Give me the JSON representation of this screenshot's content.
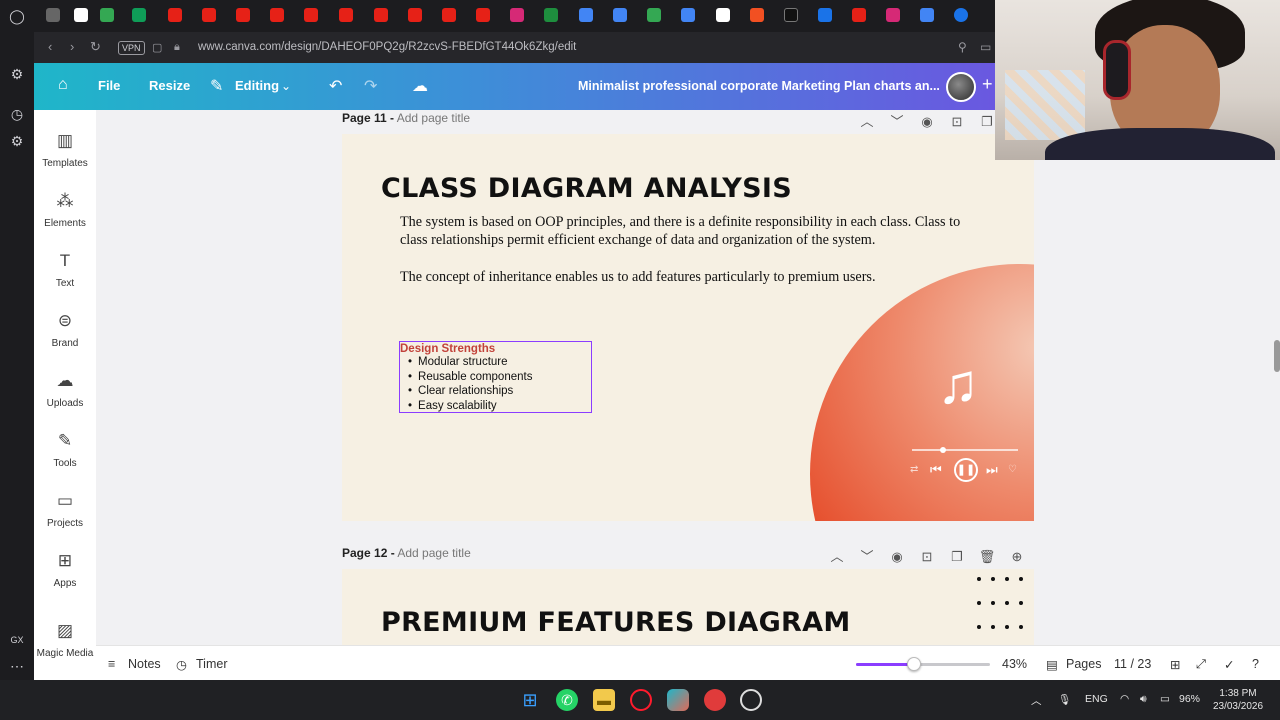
{
  "browser": {
    "vpn_label": "VPN",
    "url": "www.canva.com/design/DAHEOF0PQ2g/R2zcvS-FBEDfGT44Ok6Zkg/edit",
    "opera_label": "GX"
  },
  "header": {
    "file_label": "File",
    "resize_label": "Resize",
    "editing_label": "Editing",
    "design_title": "Minimalist professional corporate Marketing Plan charts an..."
  },
  "sidebar": {
    "items": [
      {
        "label": "Templates",
        "icon": "templates-icon"
      },
      {
        "label": "Elements",
        "icon": "elements-icon"
      },
      {
        "label": "Text",
        "icon": "text-icon"
      },
      {
        "label": "Brand",
        "icon": "brand-icon"
      },
      {
        "label": "Uploads",
        "icon": "uploads-icon"
      },
      {
        "label": "Tools",
        "icon": "tools-icon"
      },
      {
        "label": "Projects",
        "icon": "projects-icon"
      },
      {
        "label": "Apps",
        "icon": "apps-icon"
      },
      {
        "label": "Magic Media",
        "icon": "magic-media-icon"
      }
    ]
  },
  "page11": {
    "page_label": "Page 11 -",
    "page_title_placeholder": "Add page title",
    "slide_title": "CLASS DIAGRAM ANALYSIS",
    "para1": "The system is based on OOP principles, and there is a definite responsibility in each class. Class to class relationships permit efficient exchange of data and organization of the system.",
    "para2": "The concept of inheritance enables us to add features particularly to premium users.",
    "strengths_heading": "Design Strengths",
    "strengths": [
      "Modular structure",
      "Reusable components",
      "Clear relationships",
      "Easy scalability"
    ]
  },
  "page12": {
    "page_label": "Page 12 -",
    "page_title_placeholder": "Add page title",
    "slide_title": "PREMIUM FEATURES DIAGRAM"
  },
  "bottom": {
    "notes_label": "Notes",
    "timer_label": "Timer",
    "zoom_percent": "43%",
    "zoom_level": 0.43,
    "pages_label": "Pages",
    "page_count": "11 / 23"
  },
  "taskbar": {
    "language": "ENG",
    "battery": "96%",
    "time": "1:38 PM",
    "date": "23/03/2026"
  },
  "colors": {
    "accent_purple": "#8b3dff",
    "header_start": "#1fb6c9",
    "header_end": "#6a58e0",
    "slide_bg": "#f6f0e3",
    "strengths_heading": "#c2423a",
    "orange_circle": "#e6502e"
  }
}
